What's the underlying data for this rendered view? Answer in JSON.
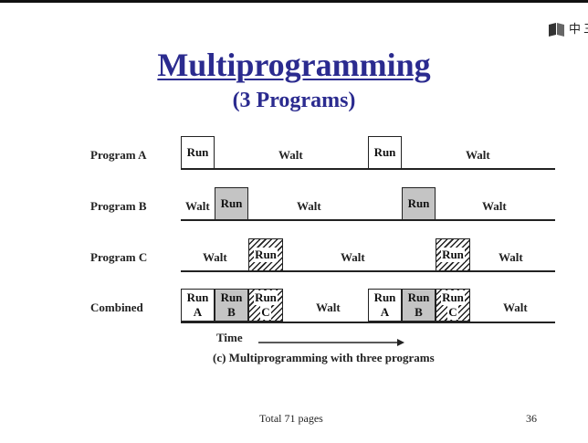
{
  "window": {
    "badge_text": "中",
    "badge_text2": "三"
  },
  "slide": {
    "title": "Multiprogramming",
    "subtitle": "(3 Programs)",
    "rows": [
      {
        "label": "Program A",
        "segments": [
          {
            "type": "box",
            "style": "plain",
            "lines": [
              "Run"
            ]
          },
          {
            "type": "text",
            "text": "Walt"
          },
          {
            "type": "box",
            "style": "plain",
            "lines": [
              "Run"
            ]
          },
          {
            "type": "text",
            "text": "Walt"
          }
        ]
      },
      {
        "label": "Program B",
        "segments": [
          {
            "type": "text",
            "text": "Walt"
          },
          {
            "type": "box",
            "style": "gray",
            "lines": [
              "Run"
            ]
          },
          {
            "type": "text",
            "text": "Walt"
          },
          {
            "type": "box",
            "style": "gray",
            "lines": [
              "Run"
            ]
          },
          {
            "type": "text",
            "text": "Walt"
          }
        ]
      },
      {
        "label": "Program C",
        "segments": [
          {
            "type": "text",
            "text": "Walt"
          },
          {
            "type": "box",
            "style": "hatch",
            "lines": [
              "Run"
            ]
          },
          {
            "type": "text",
            "text": "Walt"
          },
          {
            "type": "box",
            "style": "hatch",
            "lines": [
              "Run"
            ]
          },
          {
            "type": "text",
            "text": "Walt"
          }
        ]
      },
      {
        "label": "Combined",
        "segments": [
          {
            "type": "box",
            "style": "plain",
            "lines": [
              "Run",
              "A"
            ]
          },
          {
            "type": "box",
            "style": "gray",
            "lines": [
              "Run",
              "B"
            ]
          },
          {
            "type": "box",
            "style": "hatch",
            "lines": [
              "Run",
              "C"
            ]
          },
          {
            "type": "text",
            "text": "Walt"
          },
          {
            "type": "box",
            "style": "plain",
            "lines": [
              "Run",
              "A"
            ]
          },
          {
            "type": "box",
            "style": "gray",
            "lines": [
              "Run",
              "B"
            ]
          },
          {
            "type": "box",
            "style": "hatch",
            "lines": [
              "Run",
              "C"
            ]
          },
          {
            "type": "text",
            "text": "Walt"
          }
        ]
      }
    ],
    "time_label": "Time",
    "caption": "(c) Multiprogramming with three programs"
  },
  "footer": {
    "total": "Total 71 pages",
    "page_number": "36"
  }
}
